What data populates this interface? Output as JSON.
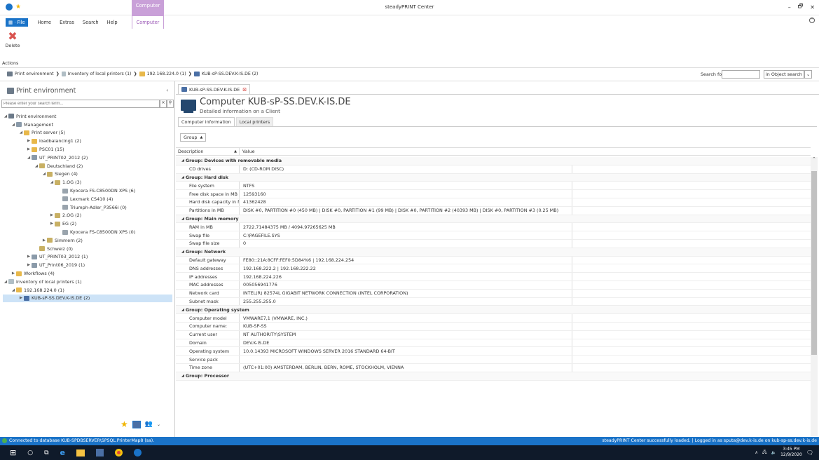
{
  "titlebar": {
    "app_title": "steadyPRINT Center",
    "context_tab": "Computer",
    "minimize": "–",
    "maximize": "🗗",
    "close": "✕"
  },
  "ribbon_tabs": {
    "file": "File",
    "home": "Home",
    "extras": "Extras",
    "search": "Search",
    "help": "Help",
    "computer": "Computer"
  },
  "ribbon": {
    "delete_label": "Delete",
    "group_label": "Actions"
  },
  "breadcrumb": {
    "items": [
      "Print environment",
      "Inventory of local printers (1)",
      "192.168.224.0 (1)",
      "KUB-sP-SS.DEV.K-IS.DE (2)"
    ],
    "search_label": "Search for",
    "search_value": "",
    "search_scope": "in  Object search"
  },
  "sidebar": {
    "title": "Print environment",
    "search_placeholder": "Please enter your search term...",
    "tree": [
      {
        "label": "Print environment",
        "depth": 0,
        "toggle": "◢"
      },
      {
        "label": "Management",
        "depth": 1,
        "toggle": "◢"
      },
      {
        "label": "Print server (5)",
        "depth": 2,
        "toggle": "◢"
      },
      {
        "label": "loadbalancing1 (2)",
        "depth": 3,
        "toggle": "▶"
      },
      {
        "label": "PSC01 (15)",
        "depth": 3,
        "toggle": "▶"
      },
      {
        "label": "UT_PRINT02_2012 (2)",
        "depth": 3,
        "toggle": "◢"
      },
      {
        "label": "Deutschland (2)",
        "depth": 4,
        "toggle": "◢"
      },
      {
        "label": "Siegen (4)",
        "depth": 5,
        "toggle": "◢"
      },
      {
        "label": "1.OG (3)",
        "depth": 6,
        "toggle": "◢"
      },
      {
        "label": "Kyocera FS-C8500DN XPS (6)",
        "depth": 7,
        "toggle": ""
      },
      {
        "label": "Lexmark CS410 (4)",
        "depth": 7,
        "toggle": ""
      },
      {
        "label": "Triumph-Adler_P3566i (0)",
        "depth": 7,
        "toggle": ""
      },
      {
        "label": "2.OG (2)",
        "depth": 6,
        "toggle": "▶"
      },
      {
        "label": "EG (2)",
        "depth": 6,
        "toggle": "▶"
      },
      {
        "label": "Kyocera FS-C8500DN XPS (0)",
        "depth": 7,
        "toggle": ""
      },
      {
        "label": "Simmern (2)",
        "depth": 5,
        "toggle": "▶"
      },
      {
        "label": "Schweiz (0)",
        "depth": 4,
        "toggle": ""
      },
      {
        "label": "UT_PRINT03_2012 (1)",
        "depth": 3,
        "toggle": "▶"
      },
      {
        "label": "UT_Print06_2019 (1)",
        "depth": 3,
        "toggle": "▶"
      },
      {
        "label": "Workflows (4)",
        "depth": 1,
        "toggle": "▶"
      },
      {
        "label": "Inventory of local printers (1)",
        "depth": 0,
        "toggle": "◢"
      },
      {
        "label": "192.168.224.0 (1)",
        "depth": 1,
        "toggle": "◢"
      },
      {
        "label": "KUB-sP-SS.DEV.K-IS.DE (2)",
        "depth": 2,
        "toggle": "▶",
        "selected": true
      }
    ]
  },
  "doc_tab": {
    "label": "KUB-sP-SS.DEV.K-IS.DE"
  },
  "header": {
    "title": "Computer KUB-sP-SS.DEV.K-IS.DE",
    "subtitle": "Detailed information on a Client"
  },
  "content_tabs": [
    "Computer information",
    "Local printers"
  ],
  "group_button": "Group",
  "grid": {
    "col_description": "Description",
    "col_value": "Value",
    "rows": [
      {
        "group": "Group: Devices with removable media"
      },
      {
        "d": "CD drives",
        "v": "D: (CD-ROM DISC)"
      },
      {
        "group": "Group: Hard disk"
      },
      {
        "d": "File system",
        "v": "NTFS"
      },
      {
        "d": "Free disk space in MB",
        "v": "12593160"
      },
      {
        "d": "Hard disk capacity in MB",
        "v": "41362428"
      },
      {
        "d": "Partitions in MB",
        "v": "DISK #0, PARTITION #0 (450 MB) | DISK #0, PARTITION #1 (99 MB) | DISK #0, PARTITION #2 (40393 MB) | DISK #0, PARTITION #3 (0.25 MB)"
      },
      {
        "group": "Group: Main memory"
      },
      {
        "d": "RAM in MB",
        "v": "2722.71484375 MB / 4094.97265625 MB"
      },
      {
        "d": "Swap file",
        "v": "C:\\PAGEFILE.SYS"
      },
      {
        "d": "Swap file size",
        "v": "0"
      },
      {
        "group": "Group: Network"
      },
      {
        "d": "Default gateway",
        "v": "FE80::21A:8CFF:FEF0:5D84%6 | 192.168.224.254"
      },
      {
        "d": "DNS addresses",
        "v": "192.168.222.2 | 192.168.222.22"
      },
      {
        "d": "IP addresses",
        "v": "192.168.224.226"
      },
      {
        "d": "MAC addresses",
        "v": "005056941776"
      },
      {
        "d": "Network card",
        "v": "INTEL(R) 82574L GIGABIT NETWORK CONNECTION (INTEL CORPORATION)"
      },
      {
        "d": "Subnet mask",
        "v": "255.255.255.0"
      },
      {
        "group": "Group: Operating system"
      },
      {
        "d": "Computer model",
        "v": "VMWARE7,1 (VMWARE, INC.)"
      },
      {
        "d": "Computer name:",
        "v": "KUB-SP-SS"
      },
      {
        "d": "Current user",
        "v": "NT AUTHORITY\\SYSTEM"
      },
      {
        "d": "Domain",
        "v": "DEV.K-IS.DE"
      },
      {
        "d": "Operating system",
        "v": "10.0.14393 MICROSOFT WINDOWS SERVER 2016 STANDARD 64-BIT"
      },
      {
        "d": "Service pack",
        "v": ""
      },
      {
        "d": "Time zone",
        "v": "(UTC+01:00) AMSTERDAM, BERLIN, BERN, ROME, STOCKHOLM, VIENNA"
      },
      {
        "group": "Group: Processor"
      }
    ]
  },
  "status": {
    "left": "Connected to database KUB-SPDBSERVER\\SPSQL.PrinterMap8 (sa).",
    "right": "steadyPRINT Center successfully loaded. | Logged in as sputa@dev.k-is.de on kub-sp-ss.dev.k-is.de"
  },
  "taskbar": {
    "time": "3:45 PM",
    "date": "12/9/2020"
  },
  "colors": {
    "accent": "#1a73c8",
    "context_tab": "#c9a0d8",
    "selection": "#cde3f7",
    "delete_icon": "#d9534f"
  }
}
